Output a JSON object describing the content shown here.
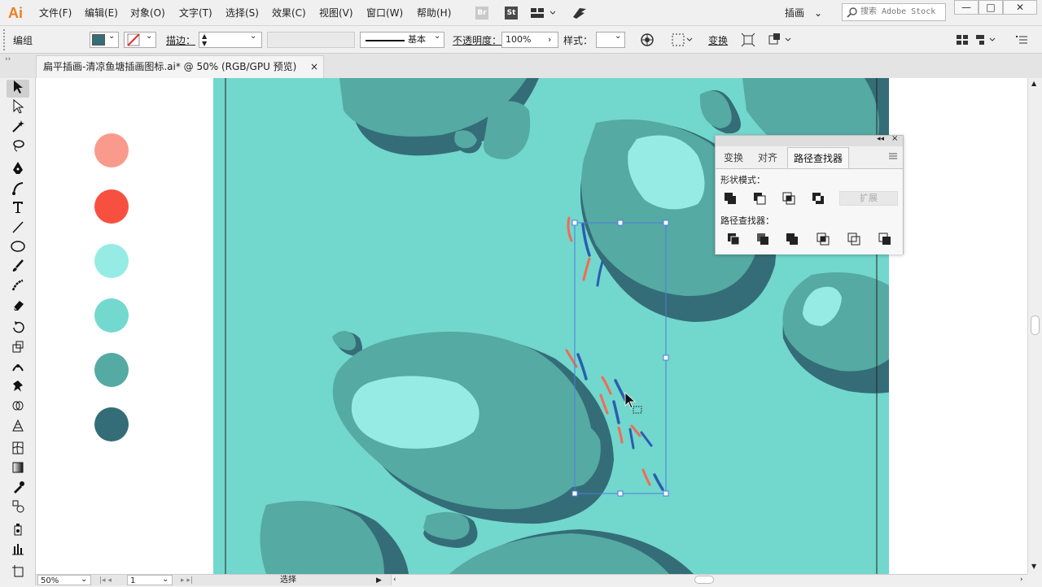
{
  "app": {
    "logo": "Ai"
  },
  "menu": [
    "文件(F)",
    "编辑(E)",
    "对象(O)",
    "文字(T)",
    "选择(S)",
    "效果(C)",
    "视图(V)",
    "窗口(W)",
    "帮助(H)"
  ],
  "menu_badges": {
    "bridge": "Br",
    "stock": "St"
  },
  "workspace": "插画",
  "search": {
    "placeholder": "搜索 Adobe Stock"
  },
  "window_buttons": {
    "minimize": "—",
    "restore": "□",
    "close": "✕"
  },
  "control_bar": {
    "selection_label": "编组",
    "stroke_label": "描边：",
    "stroke_style": "基本",
    "opacity_label": "不透明度：",
    "opacity_value": "100%",
    "style_label": "样式：",
    "transform_label": "变换"
  },
  "document_tab": {
    "title": "扁平插画-清凉鱼塘插画图标.ai* @ 50% (RGB/GPU 预览)",
    "close": "×"
  },
  "swatches": [
    "#fa9a8d",
    "#f85040",
    "#96ece4",
    "#73d9cf",
    "#55aaa3",
    "#346d77"
  ],
  "colors": {
    "fill": "#346d77",
    "water": "#72d7cd",
    "rock": "#55aaa3",
    "rock_dark": "#346d77",
    "highlight": "#96ece4"
  },
  "status": {
    "zoom": "50%",
    "page": "1",
    "tool_name": "选择"
  },
  "pathfinder_panel": {
    "tabs": [
      "变换",
      "对齐",
      "路径查找器"
    ],
    "active_tab": "路径查找器",
    "shape_modes_label": "形状模式：",
    "expand_label": "扩展",
    "pathfinders_label": "路径查找器："
  }
}
